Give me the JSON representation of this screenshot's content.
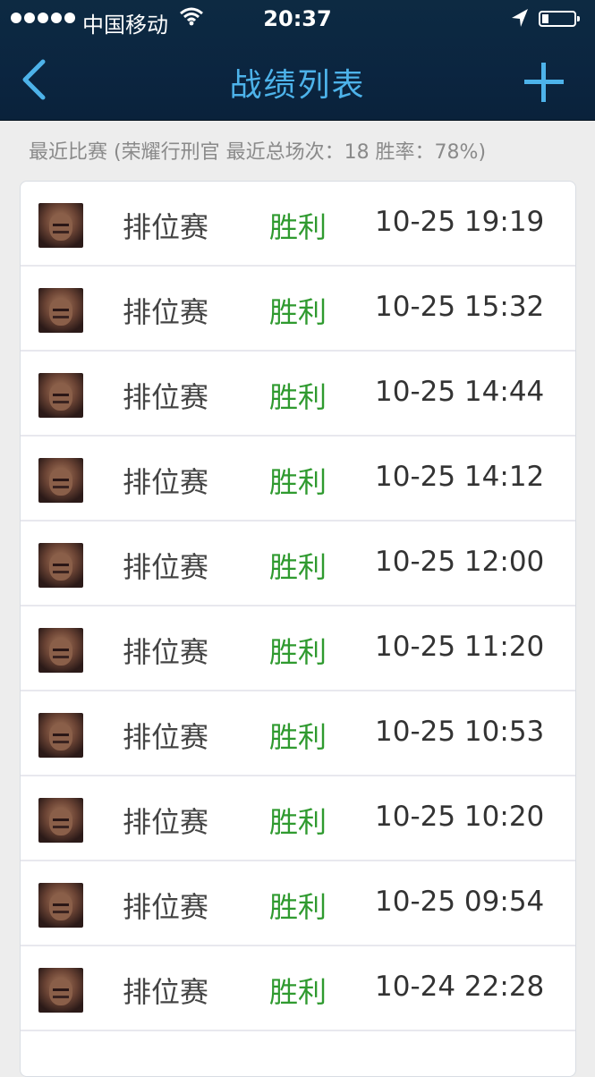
{
  "status_bar": {
    "carrier": "中国移动",
    "time": "20:37"
  },
  "nav": {
    "title": "战绩列表",
    "icons": [
      "chevron-left-icon",
      "plus-icon"
    ]
  },
  "summary": "最近比赛 (荣耀行刑官 最近总场次：18 胜率：78%)",
  "matches": [
    {
      "mode": "排位赛",
      "result": "胜利",
      "time": "10-25 19:19"
    },
    {
      "mode": "排位赛",
      "result": "胜利",
      "time": "10-25 15:32"
    },
    {
      "mode": "排位赛",
      "result": "胜利",
      "time": "10-25 14:44"
    },
    {
      "mode": "排位赛",
      "result": "胜利",
      "time": "10-25 14:12"
    },
    {
      "mode": "排位赛",
      "result": "胜利",
      "time": "10-25 12:00"
    },
    {
      "mode": "排位赛",
      "result": "胜利",
      "time": "10-25 11:20"
    },
    {
      "mode": "排位赛",
      "result": "胜利",
      "time": "10-25 10:53"
    },
    {
      "mode": "排位赛",
      "result": "胜利",
      "time": "10-25 10:20"
    },
    {
      "mode": "排位赛",
      "result": "胜利",
      "time": "10-25 09:54"
    },
    {
      "mode": "排位赛",
      "result": "胜利",
      "time": "10-24 22:28"
    }
  ],
  "colors": {
    "nav_bg": "#0b2540",
    "accent": "#4db3ea",
    "win": "#2f9a2f"
  }
}
